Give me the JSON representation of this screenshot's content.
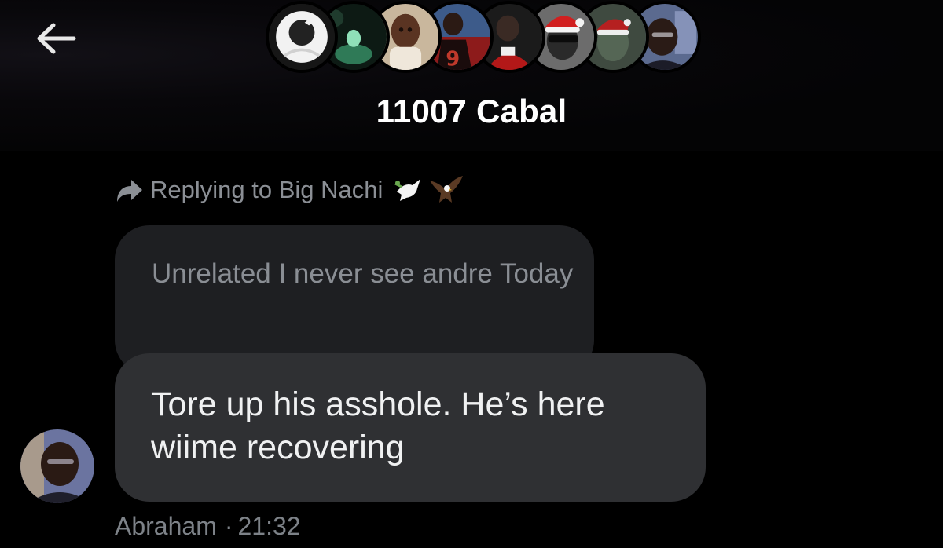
{
  "header": {
    "title": "11007 Cabal",
    "back_icon": "arrow-left-icon",
    "participants": [
      {
        "name": "participant-1",
        "type": "default-avatar"
      },
      {
        "name": "participant-2",
        "type": "photo"
      },
      {
        "name": "participant-3",
        "type": "photo"
      },
      {
        "name": "participant-4",
        "type": "photo"
      },
      {
        "name": "participant-5",
        "type": "photo"
      },
      {
        "name": "participant-6",
        "type": "photo"
      },
      {
        "name": "participant-7",
        "type": "photo"
      },
      {
        "name": "participant-8",
        "type": "photo"
      }
    ]
  },
  "reply": {
    "label": "Replying to Big Nachi",
    "icon": "reply-arrow-icon",
    "name_emojis": [
      "dove-icon",
      "eagle-icon"
    ]
  },
  "quoted_message": {
    "text": "Unrelated I never see andre Today"
  },
  "message": {
    "text": "Tore up his asshole. He’s here wiime recovering",
    "sender": "Abraham",
    "separator": "·",
    "time": "21:32"
  },
  "colors": {
    "background": "#000000",
    "quoted_bubble": "#1e1f22",
    "message_bubble": "#2f3033",
    "muted_text": "#8b8f95",
    "title_text": "#ffffff"
  }
}
